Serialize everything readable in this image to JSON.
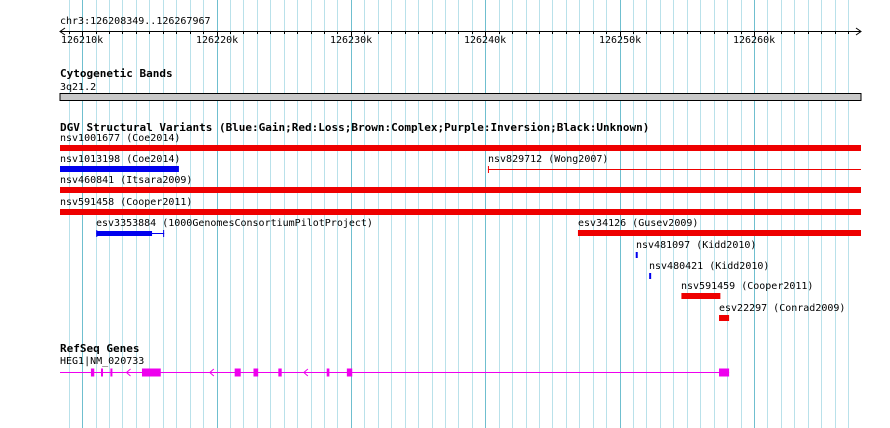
{
  "locus": "chr3:126208349..126267967",
  "ruler": {
    "start": 126208349,
    "end": 126267967,
    "ticks": [
      {
        "pos": 126210000,
        "label": "126210k"
      },
      {
        "pos": 126220000,
        "label": "126220k"
      },
      {
        "pos": 126230000,
        "label": "126230k"
      },
      {
        "pos": 126240000,
        "label": "126240k"
      },
      {
        "pos": 126250000,
        "label": "126250k"
      },
      {
        "pos": 126260000,
        "label": "126260k"
      }
    ]
  },
  "tracks": {
    "cytoband": {
      "title": "Cytogenetic Bands",
      "band": "3q21.2"
    },
    "dgv": {
      "title": "DGV Structural Variants (Blue:Gain;Red:Loss;Brown:Complex;Purple:Inversion;Black:Unknown)",
      "colors": {
        "gain": "#0000ee",
        "loss": "#ee0000"
      },
      "features": [
        {
          "id": "nsv1001677",
          "label": "nsv1001677 (Coe2014)",
          "type": "loss",
          "style": "bar",
          "start": 126208349,
          "end": 126267967,
          "row": 0
        },
        {
          "id": "nsv1013198",
          "label": "nsv1013198 (Coe2014)",
          "type": "gain",
          "style": "bar",
          "start": 126208349,
          "end": 126217200,
          "row": 1
        },
        {
          "id": "nsv829712",
          "label": "nsv829712 (Wong2007)",
          "type": "loss",
          "style": "line",
          "start": 126240200,
          "end": 126267967,
          "row": 1
        },
        {
          "id": "nsv460841",
          "label": "nsv460841 (Itsara2009)",
          "type": "loss",
          "style": "bar",
          "start": 126208349,
          "end": 126267967,
          "row": 2
        },
        {
          "id": "nsv591458",
          "label": "nsv591458 (Cooper2011)",
          "type": "loss",
          "style": "bar",
          "start": 126208349,
          "end": 126267967,
          "row": 3
        },
        {
          "id": "esv3353884",
          "label": "esv3353884 (1000GenomesConsortiumPilotProject)",
          "type": "gain",
          "style": "bracket",
          "start": 126211050,
          "end": 126216100,
          "innerStart": 126211050,
          "innerEnd": 126215200,
          "row": 4
        },
        {
          "id": "esv34126",
          "label": "esv34126 (Gusev2009)",
          "type": "loss",
          "style": "bar",
          "start": 126246900,
          "end": 126267967,
          "row": 4
        },
        {
          "id": "nsv481097",
          "label": "nsv481097 (Kidd2010)",
          "type": "gain",
          "style": "tick",
          "start": 126251200,
          "end": 126251300,
          "row": 5
        },
        {
          "id": "nsv480421",
          "label": "nsv480421 (Kidd2010)",
          "type": "gain",
          "style": "tick",
          "start": 126252200,
          "end": 126252300,
          "row": 6
        },
        {
          "id": "nsv591459",
          "label": "nsv591459 (Cooper2011)",
          "type": "loss",
          "style": "bar",
          "start": 126254600,
          "end": 126257500,
          "row": 7
        },
        {
          "id": "esv22297",
          "label": "esv22297 (Conrad2009)",
          "type": "loss",
          "style": "bar",
          "start": 126257400,
          "end": 126258150,
          "row": 8
        }
      ]
    },
    "refseq": {
      "title": "RefSeq Genes",
      "gene_label": "HEG1|NM_020733",
      "color": "#ee00ee",
      "start": 126208349,
      "end": 126258150,
      "exons": [
        {
          "start": 126210650,
          "end": 126210900
        },
        {
          "start": 126211400,
          "end": 126211500
        },
        {
          "start": 126212100,
          "end": 126212250
        },
        {
          "start": 126214450,
          "end": 126215850
        },
        {
          "start": 126221350,
          "end": 126221800
        },
        {
          "start": 126222750,
          "end": 126223100
        },
        {
          "start": 126224600,
          "end": 126224850
        },
        {
          "start": 126228200,
          "end": 126228400
        },
        {
          "start": 126229700,
          "end": 126230100
        },
        {
          "start": 126257400,
          "end": 126258150
        }
      ]
    }
  }
}
